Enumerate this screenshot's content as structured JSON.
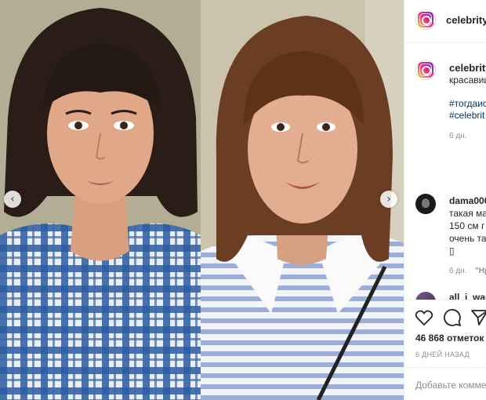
{
  "post": {
    "nav_prev": "‹",
    "nav_next": "›"
  },
  "header": {
    "username": "celebrity_"
  },
  "caption": {
    "username": "celebrity",
    "text": "красавиц",
    "tag1": "#тогдаис",
    "tag2": "#celebrit",
    "time": "6 дн."
  },
  "comments": [
    {
      "username": "dama000",
      "lines": [
        "такая ма",
        "150 см г",
        "очень та",
        "▯"
      ],
      "time": "6 дн.",
      "reply": "\"Нр"
    },
    {
      "username": "all_i_wan"
    }
  ],
  "actions": {
    "like_icon": "heart-icon",
    "comment_icon": "comment-icon",
    "share_icon": "share-icon"
  },
  "likes": "46 868 отметок",
  "posted_ago": "6 ДНЕЙ НАЗАД",
  "comment_placeholder": "Добавьте комме",
  "colors": {
    "link": "#00376b",
    "muted": "#8e8e8e",
    "text": "#262626"
  }
}
